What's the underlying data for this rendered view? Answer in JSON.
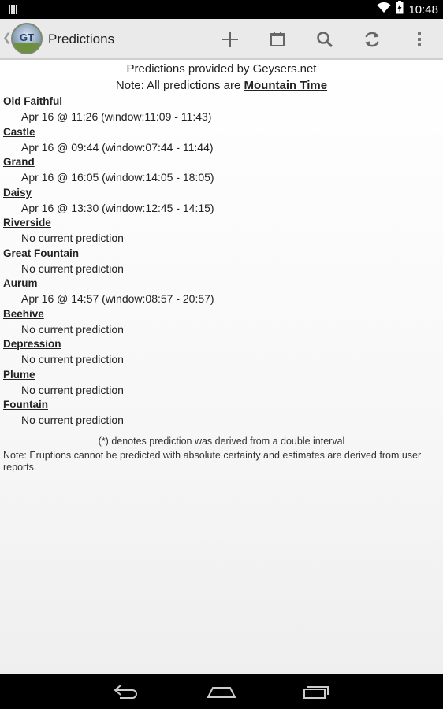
{
  "status_bar": {
    "time": "10:48",
    "icons": [
      "notification-icon",
      "wifi-icon",
      "battery-icon"
    ]
  },
  "action_bar": {
    "app_logo_text": "GT",
    "title": "Predictions",
    "actions": [
      "add-icon",
      "calendar-icon",
      "search-icon",
      "refresh-icon",
      "overflow-menu-icon"
    ]
  },
  "header": {
    "provided_by": "Predictions provided by Geysers.net",
    "note_prefix": "Note: All predictions are ",
    "timezone": "Mountain Time"
  },
  "geysers": [
    {
      "name": "Old Faithful",
      "prediction": "Apr 16 @ 11:26 (window:11:09 - 11:43)"
    },
    {
      "name": "Castle",
      "prediction": "Apr 16 @ 09:44 (window:07:44 - 11:44)"
    },
    {
      "name": "Grand",
      "prediction": "Apr 16 @ 16:05 (window:14:05 - 18:05)"
    },
    {
      "name": "Daisy",
      "prediction": "Apr 16 @ 13:30 (window:12:45 - 14:15)"
    },
    {
      "name": "Riverside",
      "prediction": "No current prediction"
    },
    {
      "name": "Great Fountain",
      "prediction": "No current prediction"
    },
    {
      "name": "Aurum",
      "prediction": "Apr 16 @ 14:57 (window:08:57 - 20:57)"
    },
    {
      "name": "Beehive",
      "prediction": "No current prediction"
    },
    {
      "name": "Depression",
      "prediction": "No current prediction"
    },
    {
      "name": "Plume",
      "prediction": "No current prediction"
    },
    {
      "name": "Fountain",
      "prediction": "No current prediction"
    }
  ],
  "footnotes": {
    "double_interval": "(*) denotes prediction was derived from a double interval",
    "disclaimer": "Note: Eruptions cannot be predicted with absolute certainty and estimates are derived from user reports."
  },
  "nav_bar": {
    "buttons": [
      "back-icon",
      "home-icon",
      "recent-apps-icon"
    ]
  }
}
